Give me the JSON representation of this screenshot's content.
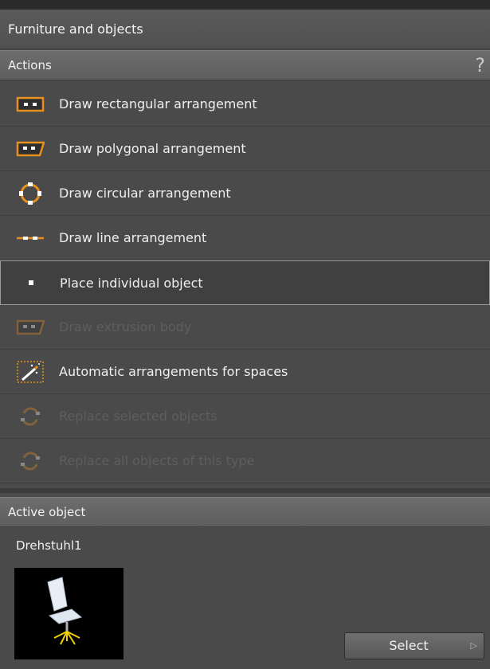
{
  "panel": {
    "title": "Furniture and objects"
  },
  "actions": {
    "header": "Actions",
    "help": "?",
    "items": [
      {
        "label": "Draw rectangular arrangement",
        "icon": "rectangular-arrangement-icon",
        "state": "normal"
      },
      {
        "label": "Draw polygonal arrangement",
        "icon": "polygonal-arrangement-icon",
        "state": "normal"
      },
      {
        "label": "Draw circular arrangement",
        "icon": "circular-arrangement-icon",
        "state": "normal"
      },
      {
        "label": "Draw line arrangement",
        "icon": "line-arrangement-icon",
        "state": "normal"
      },
      {
        "label": "Place individual object",
        "icon": "single-object-icon",
        "state": "selected"
      },
      {
        "label": "Draw extrusion body",
        "icon": "extrusion-body-icon",
        "state": "disabled"
      },
      {
        "label": "Automatic arrangements for spaces",
        "icon": "magic-wand-icon",
        "state": "normal"
      },
      {
        "label": "Replace selected objects",
        "icon": "replace-icon",
        "state": "disabled"
      },
      {
        "label": "Replace all objects of this type",
        "icon": "replace-all-icon",
        "state": "disabled"
      }
    ]
  },
  "active_object": {
    "header": "Active object",
    "name": "Drehstuhl1",
    "thumbnail_icon": "office-chair-icon",
    "select_label": "Select",
    "select_arrow": "▷"
  },
  "colors": {
    "accent": "#e8901e",
    "panel_bg": "#4a4a4a",
    "header_bg": "#666666"
  }
}
